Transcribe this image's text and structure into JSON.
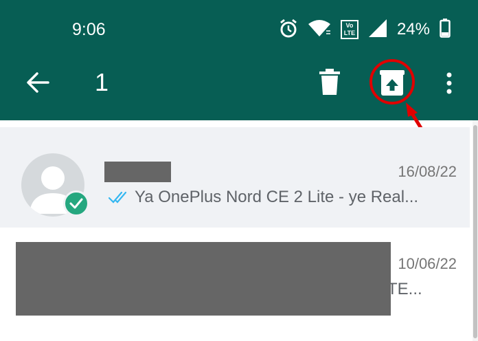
{
  "status_bar": {
    "time": "9:06",
    "volte_label": "Vo LTE",
    "battery_text": "24%"
  },
  "app_bar": {
    "selected_count": "1"
  },
  "chats": [
    {
      "date": "16/08/22",
      "preview": "Ya OnePlus Nord CE 2 Lite - ye Real...",
      "selected": true
    },
    {
      "date": "10/06/22",
      "preview": "TE...",
      "selected": false
    }
  ],
  "colors": {
    "header_bg": "#075e54",
    "selected_row_bg": "#f0f2f5",
    "check_badge": "#25a77f",
    "read_ticks": "#34b7f1",
    "annotation_red": "#e00000"
  }
}
